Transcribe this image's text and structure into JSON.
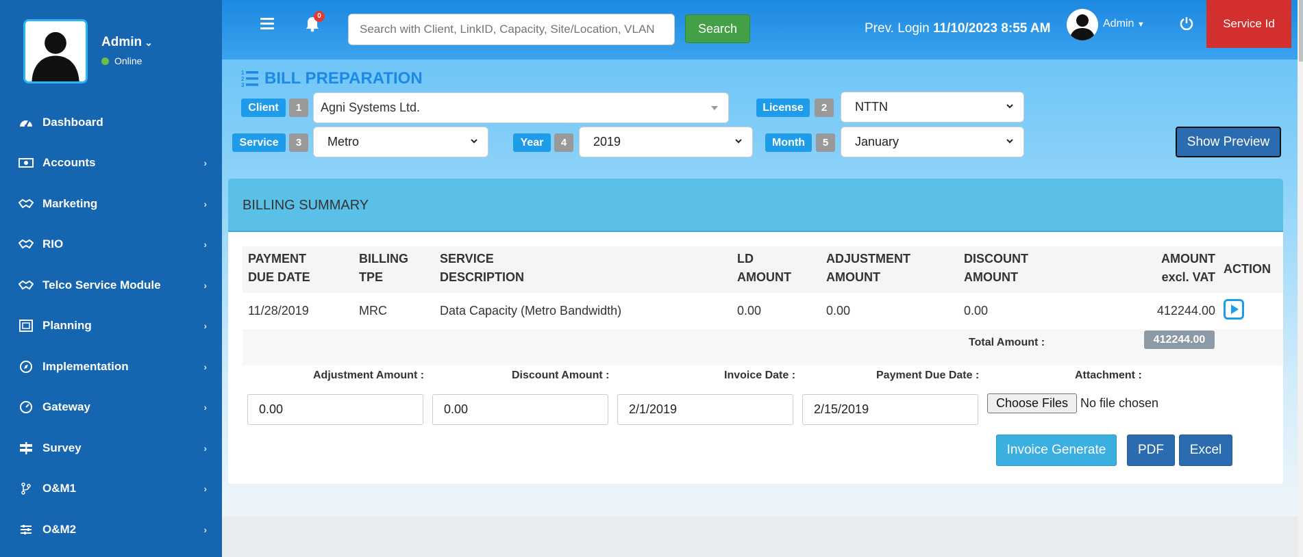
{
  "user": {
    "name": "Admin",
    "status": "Online"
  },
  "sidebar": {
    "items": [
      {
        "label": "Dashboard",
        "icon": "dashboard-icon",
        "arrow": ""
      },
      {
        "label": "Accounts",
        "icon": "money-icon",
        "arrow": "›"
      },
      {
        "label": "Marketing",
        "icon": "handshake-icon",
        "arrow": "›"
      },
      {
        "label": "RIO",
        "icon": "handshake-icon",
        "arrow": "›"
      },
      {
        "label": "Telco Service Module",
        "icon": "handshake-icon",
        "arrow": "›"
      },
      {
        "label": "Planning",
        "icon": "blueprint-icon",
        "arrow": "›"
      },
      {
        "label": "Implementation",
        "icon": "compass-icon",
        "arrow": "›"
      },
      {
        "label": "Gateway",
        "icon": "gauge-icon",
        "arrow": "›"
      },
      {
        "label": "Survey",
        "icon": "signpost-icon",
        "arrow": "›"
      },
      {
        "label": "O&M1",
        "icon": "branch-icon",
        "arrow": "›"
      },
      {
        "label": "O&M2",
        "icon": "sliders-icon",
        "arrow": "›"
      }
    ]
  },
  "topbar": {
    "notification_count": "0",
    "search_placeholder": "Search with Client, LinkID, Capacity, Site/Location, VLAN",
    "search_label": "Search",
    "prev_login_label": "Prev. Login",
    "prev_login_value": "11/10/2023 8:55 AM",
    "user_label": "Admin",
    "service_id_label": "Service Id"
  },
  "page": {
    "title": "BILL PREPARATION",
    "client": {
      "label": "Client",
      "num": "1",
      "value": "Agni Systems Ltd."
    },
    "license": {
      "label": "License",
      "num": "2",
      "value": "NTTN"
    },
    "service": {
      "label": "Service",
      "num": "3",
      "value": "Metro"
    },
    "year": {
      "label": "Year",
      "num": "4",
      "value": "2019"
    },
    "month": {
      "label": "Month",
      "num": "5",
      "value": "January"
    },
    "show_preview_label": "Show Preview"
  },
  "summary": {
    "title": "BILLING SUMMARY",
    "headers": {
      "payment_due_1": "PAYMENT",
      "payment_due_2": "DUE DATE",
      "billing_1": "BILLING",
      "billing_2": "TPE",
      "service_1": "SERVICE",
      "service_2": "DESCRIPTION",
      "ld_1": "LD",
      "ld_2": "AMOUNT",
      "adj_1": "ADJUSTMENT",
      "adj_2": "AMOUNT",
      "disc_1": "DISCOUNT",
      "disc_2": "AMOUNT",
      "amount_1": "AMOUNT",
      "amount_2": "excl. VAT",
      "action": "ACTION"
    },
    "row": {
      "payment_due_date": "11/28/2019",
      "billing_type": "MRC",
      "service_description": "Data Capacity (Metro Bandwidth)",
      "ld_amount": "0.00",
      "adjustment_amount": "0.00",
      "discount_amount": "0.00",
      "amount_excl_vat": "412244.00"
    },
    "total_label": "Total Amount :",
    "total_value": "412244.00"
  },
  "form": {
    "adjustment_label": "Adjustment Amount :",
    "discount_label": "Discount Amount :",
    "invoice_date_label": "Invoice Date :",
    "payment_due_label": "Payment Due Date :",
    "attachment_label": "Attachment :",
    "adjustment_value": "0.00",
    "discount_value": "0.00",
    "invoice_date_value": "2/1/2019",
    "payment_due_value": "2/15/2019",
    "choose_files_label": "Choose Files",
    "no_file_text": "No file chosen",
    "invoice_generate_label": "Invoice Generate",
    "pdf_label": "PDF",
    "excel_label": "Excel"
  },
  "colors": {
    "sidebar": "#1565b0",
    "accent": "#1e9be9",
    "success": "#43a047",
    "danger": "#d32f2f"
  }
}
